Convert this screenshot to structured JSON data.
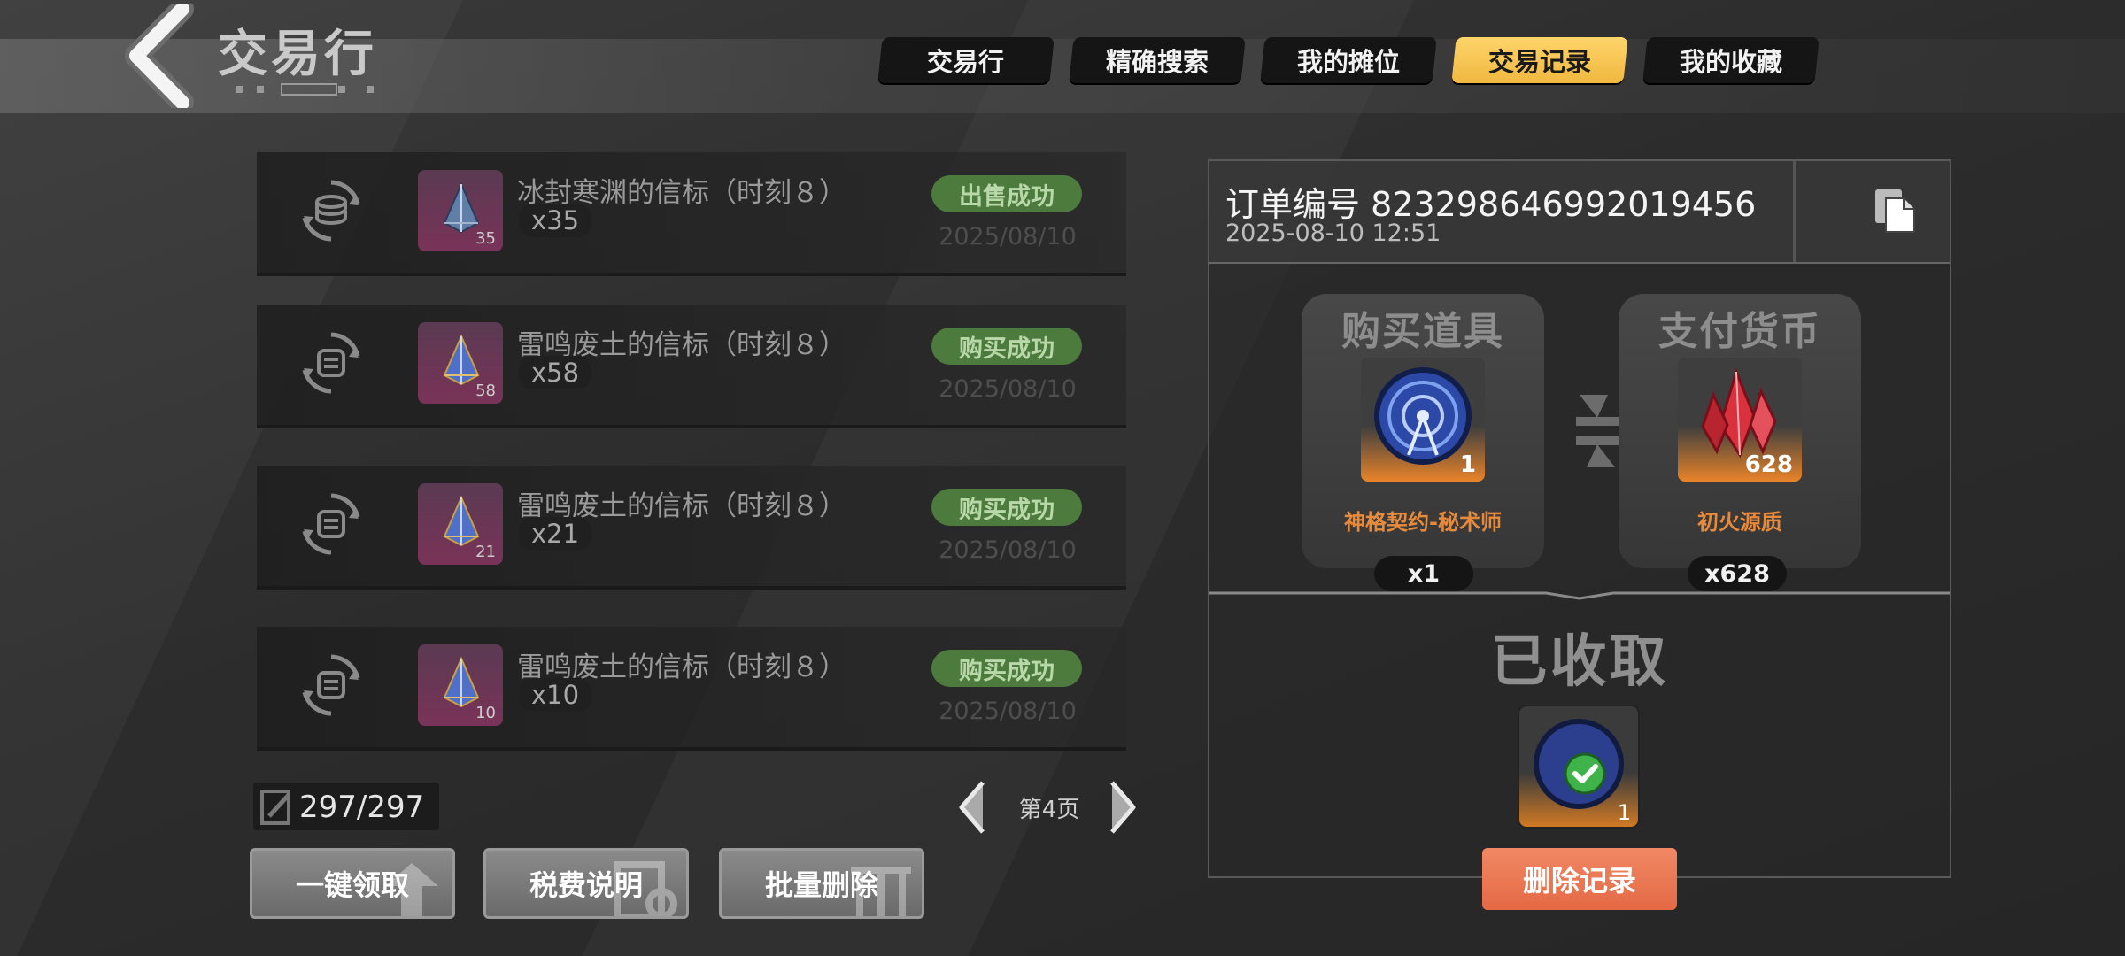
{
  "header": {
    "title": "交易行",
    "tabs": [
      {
        "label": "交易行",
        "active": false
      },
      {
        "label": "精确搜索",
        "active": false
      },
      {
        "label": "我的摊位",
        "active": false
      },
      {
        "label": "交易记录",
        "active": true
      },
      {
        "label": "我的收藏",
        "active": false
      }
    ]
  },
  "records": [
    {
      "icon": "coin-stack-exchange-icon",
      "item_icon": "beacon-gem-icon",
      "item_count": "35",
      "name": "冰封寒渊的信标（时刻８）",
      "qty": "x35",
      "status": "出售成功",
      "date": "2025/08/10"
    },
    {
      "icon": "exchange-icon",
      "item_icon": "beacon-gem-icon",
      "item_count": "58",
      "name": "雷鸣废土的信标（时刻８）",
      "qty": "x58",
      "status": "购买成功",
      "date": "2025/08/10"
    },
    {
      "icon": "exchange-icon",
      "item_icon": "beacon-gem-icon",
      "item_count": "21",
      "name": "雷鸣废土的信标（时刻８）",
      "qty": "x21",
      "status": "购买成功",
      "date": "2025/08/10"
    },
    {
      "icon": "exchange-icon",
      "item_icon": "beacon-gem-icon",
      "item_count": "10",
      "name": "雷鸣废土的信标（时刻８）",
      "qty": "x10",
      "status": "购买成功",
      "date": "2025/08/10"
    }
  ],
  "counter": "297/297",
  "pager": {
    "label": "第4页"
  },
  "buttons": {
    "claim_all": "一键领取",
    "tax_info": "税费说明",
    "batch_delete": "批量删除"
  },
  "detail": {
    "order_no": "订单编号 823298646992019456",
    "time": "2025-08-10 12:51",
    "buy": {
      "title": "购买道具",
      "item_count": "1",
      "name": "神格契约-秘术师",
      "qty": "x1"
    },
    "pay": {
      "title": "支付货币",
      "item_count": "628",
      "name": "初火源质",
      "qty": "x628"
    },
    "received_label": "已收取",
    "received_count": "1",
    "delete_button": "删除记录"
  },
  "colors": {
    "active_tab": "#f5c453",
    "status_green": "#4c7b3d",
    "delete_orange": "#e96f4a",
    "item_name_orange": "#e78a3c"
  }
}
